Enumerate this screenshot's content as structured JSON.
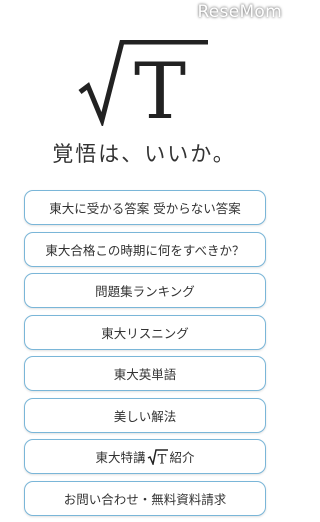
{
  "watermark": "ReseMom",
  "logo": {
    "letter": "T",
    "alt": "√T"
  },
  "tagline": "覚悟は、いいか。",
  "menu": {
    "items": [
      {
        "label": "東大に受かる答案 受からない答案"
      },
      {
        "label": "東大合格この時期に何をすべきか？"
      },
      {
        "label": "問題集ランキング"
      },
      {
        "label": "東大リスニング"
      },
      {
        "label": "東大英単語"
      },
      {
        "label": "美しい解法"
      },
      {
        "label_before": "東大特講",
        "label_after": "紹介"
      },
      {
        "label": "お問い合わせ・無料資料請求"
      }
    ]
  },
  "colors": {
    "button_border": "#7ab6d8",
    "text": "#333333"
  }
}
